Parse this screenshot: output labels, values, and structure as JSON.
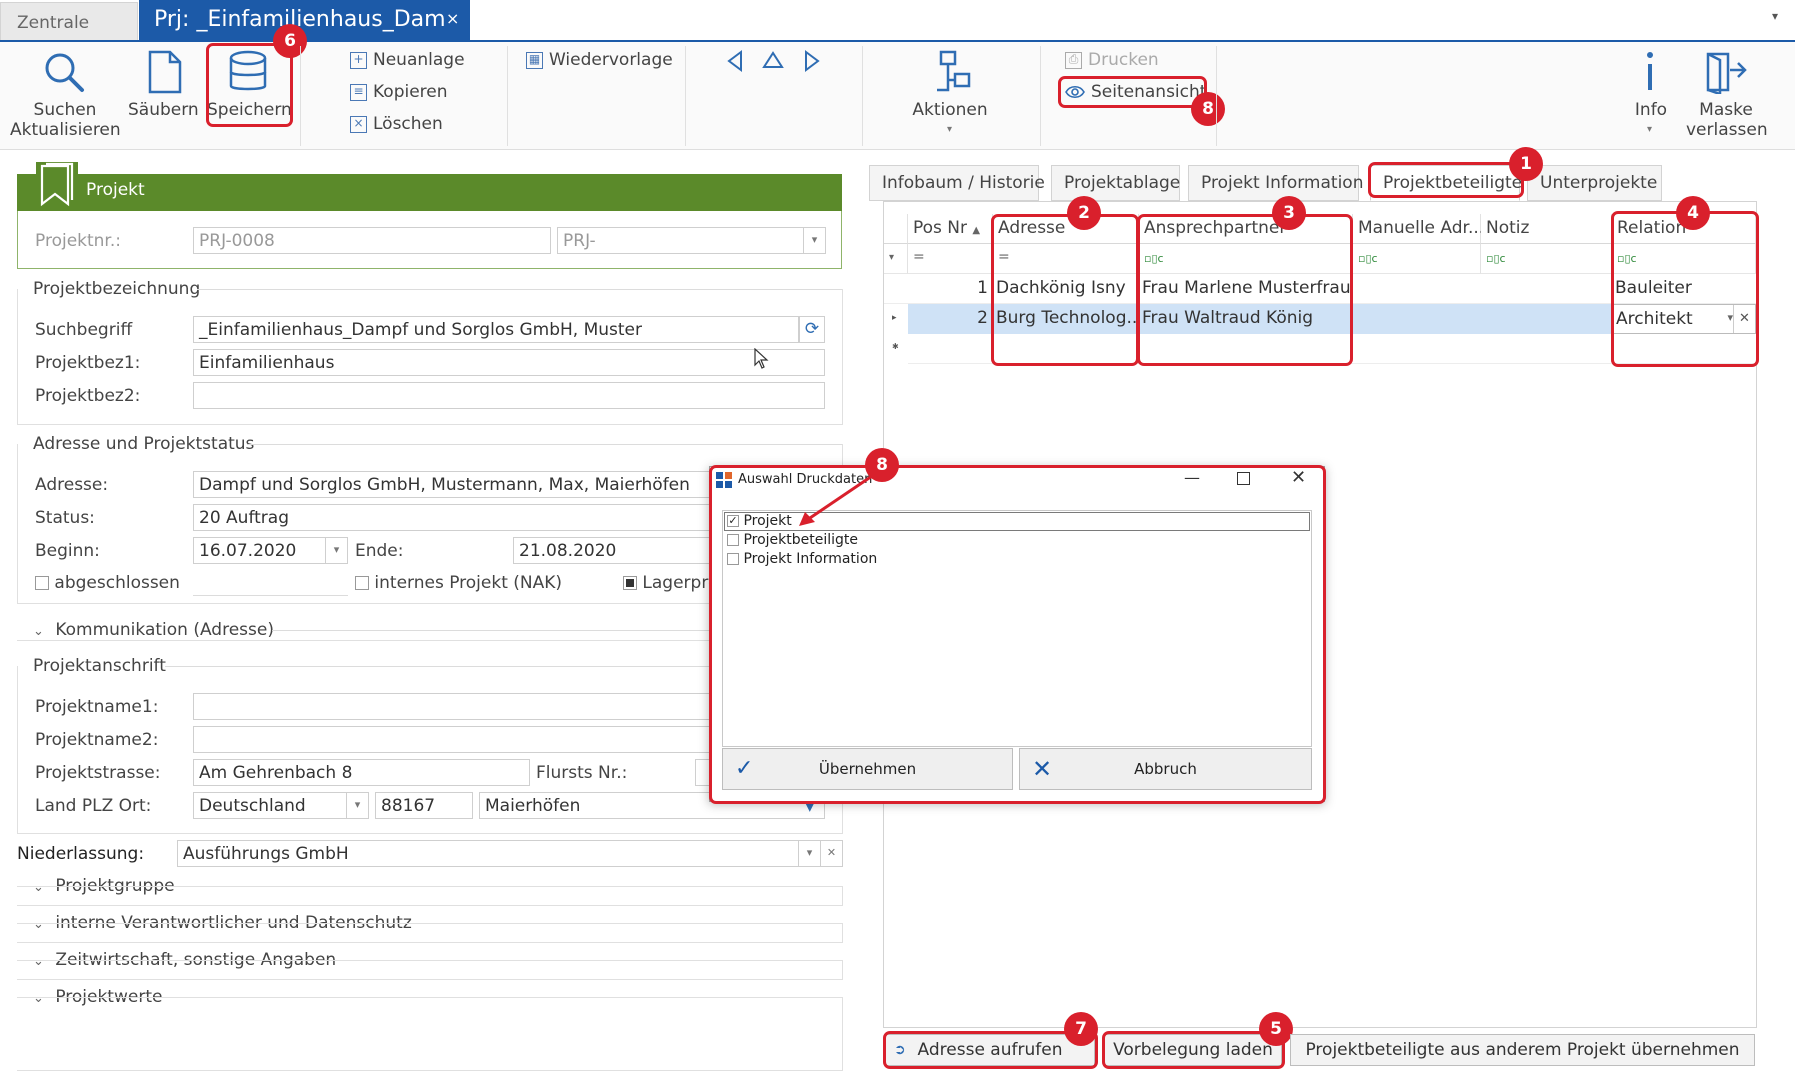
{
  "tabs": {
    "zentrale": "Zentrale",
    "project": "Prj: _Einfamilienhaus_Dam",
    "close": "×",
    "menu": "▾"
  },
  "ribbon": {
    "suchen": "Suchen",
    "aktualisieren": "Aktualisieren",
    "saeubern": "Säubern",
    "speichern": "Speichern",
    "neuanlage": "Neuanlage",
    "kopieren": "Kopieren",
    "loeschen": "Löschen",
    "wiedervorlage": "Wiedervorlage",
    "aktionen": "Aktionen",
    "drucken": "Drucken",
    "seitenansicht": "Seitenansicht",
    "info": "Info",
    "maske": "Maske",
    "verlassen": "verlassen"
  },
  "project": {
    "header": "Projekt",
    "projektnr_label": "Projektnr.:",
    "projektnr": "PRJ-0008",
    "prefix": "PRJ-",
    "bezeichnung_group": "Projektbezeichnung",
    "suchbegriff_label": "Suchbegriff",
    "suchbegriff": "_Einfamilienhaus_Dampf und Sorglos GmbH, Muster",
    "projektbez1_label": "Projektbez1:",
    "projektbez1": "Einfamilienhaus",
    "projektbez2_label": "Projektbez2:",
    "projektbez2": "",
    "adresse_group": "Adresse und Projektstatus",
    "adresse_label": "Adresse:",
    "adresse": "Dampf und Sorglos GmbH, Mustermann, Max, Maierhöfen",
    "status_label": "Status:",
    "status": "20 Auftrag",
    "beginn_label": "Beginn:",
    "beginn": "16.07.2020",
    "ende_label": "Ende:",
    "ende": "21.08.2020",
    "abgeschlossen": "abgeschlossen",
    "intern": "internes Projekt (NAK)",
    "lager": "Lagerpro",
    "kommunikation": "Kommunikation (Adresse)",
    "anschrift_group": "Projektanschrift",
    "name1_label": "Projektname1:",
    "name2_label": "Projektname2:",
    "strasse_label": "Projektstrasse:",
    "strasse": "Am Gehrenbach 8",
    "flurst_label": "Flursts Nr.:",
    "landplz_label": "Land PLZ Ort:",
    "land": "Deutschland",
    "plz": "88167",
    "ort": "Maierhöfen",
    "niederlassung_label": "Niederlassung:",
    "niederlassung": "Ausführungs GmbH",
    "projektgruppe": "Projektgruppe",
    "verantwortliche": "interne Verantwortlicher und Datenschutz",
    "zeitwirtschaft": "Zeitwirtschaft, sonstige Angaben",
    "projektwerte": "Projektwerte"
  },
  "right_tabs": [
    "Infobaum / Historie",
    "Projektablage",
    "Projekt Information",
    "Projektbeteiligte",
    "Unterprojekte"
  ],
  "grid": {
    "headers": [
      "Pos Nr",
      "Adresse",
      "Ansprechpartner",
      "Manuelle Adr...",
      "Notiz",
      "Relation"
    ],
    "filter_eq": "=",
    "filter_abc": "▫▯c",
    "rows": [
      {
        "pos": "1",
        "adresse": "Dachkönig Isny",
        "ansprechpartner": "Frau Marlene Musterfrau",
        "relation": "Bauleiter"
      },
      {
        "pos": "2",
        "adresse": "Burg Technolog...",
        "ansprechpartner": "Frau Waltraud König",
        "relation": "Architekt"
      }
    ]
  },
  "dialog": {
    "title": "Auswahl Druckdaten",
    "items": [
      "Projekt",
      "Projektbeteiligte",
      "Projekt Information"
    ],
    "ok": "Übernehmen",
    "cancel": "Abbruch"
  },
  "bottom": {
    "adresse": "Adresse aufrufen",
    "vorbelegung": "Vorbelegung laden",
    "uebernehmen": "Projektbeteiligte aus anderem Projekt übernehmen"
  },
  "badges": [
    "1",
    "2",
    "3",
    "4",
    "5",
    "6",
    "7",
    "8",
    "8"
  ],
  "colors": {
    "accent": "#1c5aa8",
    "header_green": "#5b8a2a",
    "annotation": "#d9202c",
    "selection": "#cfe2f6"
  }
}
